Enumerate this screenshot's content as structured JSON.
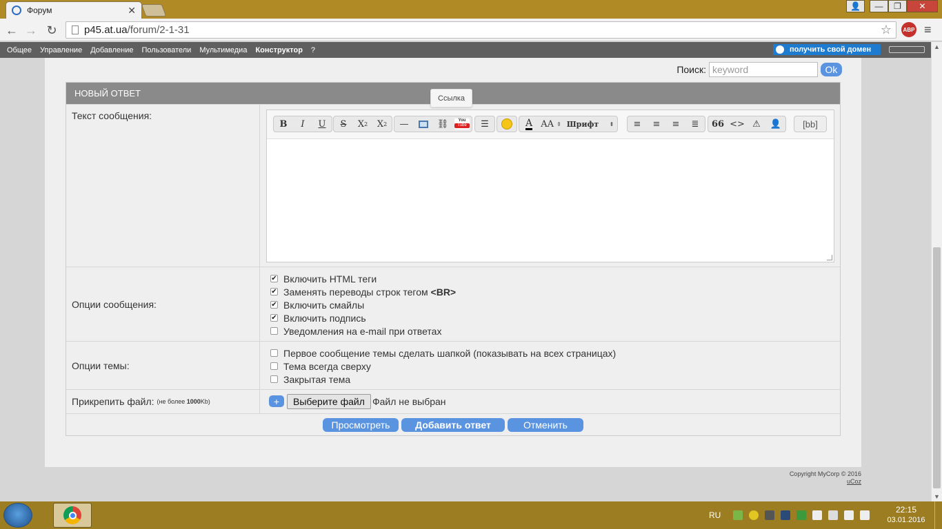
{
  "browser": {
    "tab_title": "Форум",
    "tab_close": "✕",
    "url_domain": "p45.at.ua",
    "url_path": "/forum/2-1-31",
    "abp_label": "ABP",
    "window_controls": {
      "minimize": "—",
      "maximize": "❐",
      "close": "✕"
    }
  },
  "ucoz_panel": {
    "items": [
      "Общее",
      "Управление",
      "Добавление",
      "Пользователи",
      "Мультимедиа",
      "Конструктор",
      "?"
    ],
    "domain_button": "получить свой домен"
  },
  "search": {
    "label": "Поиск:",
    "placeholder": "keyword",
    "button": "Ok"
  },
  "form": {
    "header": "НОВЫЙ ОТВЕТ",
    "message_label": "Текст сообщения:",
    "toolbar": {
      "bold": "B",
      "italic": "I",
      "underline": "U",
      "strike": "S",
      "sup": "X",
      "sub": "X",
      "sup_mark": "2",
      "sub_mark": "2",
      "font_size": "AA",
      "font": "Шрифт",
      "tooltip": "Ссылка",
      "bb": "[bb]",
      "youtube_top": "You",
      "youtube_bottom": "Tube",
      "text_color": "A",
      "quote": "66",
      "code": "<>"
    },
    "message_options_label": "Опции сообщения:",
    "message_options": [
      {
        "label": "Включить HTML теги",
        "checked": true
      },
      {
        "label": "Заменять переводы строк тегом",
        "bold_tail": "<BR>",
        "checked": true
      },
      {
        "label": "Включить смайлы",
        "checked": true
      },
      {
        "label": "Включить подпись",
        "checked": true
      },
      {
        "label": "Уведомления на e-mail при ответах",
        "checked": false
      }
    ],
    "topic_options_label": "Опции темы:",
    "topic_options": [
      {
        "label": "Первое сообщение темы сделать шапкой (показывать на всех страницах)",
        "checked": false
      },
      {
        "label": "Тема всегда сверху",
        "checked": false
      },
      {
        "label": "Закрытая тема",
        "checked": false
      }
    ],
    "attach_label": "Прикрепить файл:",
    "attach_note_prefix": "(не более ",
    "attach_note_size": "1000",
    "attach_note_suffix": "Kb)",
    "attach_plus": "+",
    "file_button": "Выберите файл",
    "file_status": "Файл не выбран",
    "buttons": {
      "preview": "Просмотреть",
      "submit": "Добавить ответ",
      "cancel": "Отменить"
    }
  },
  "footer": {
    "copyright": "Copyright MyCorp © 2016",
    "ucoz": "uCoz"
  },
  "taskbar": {
    "lang": "RU",
    "time": "22:15",
    "date": "03.01.2016"
  },
  "colors": {
    "accent_button": "#5a94e0",
    "form_header": "#8a8a8a",
    "ucoz_panel": "#5f5f5f",
    "taskbar": "#9c7d22"
  }
}
